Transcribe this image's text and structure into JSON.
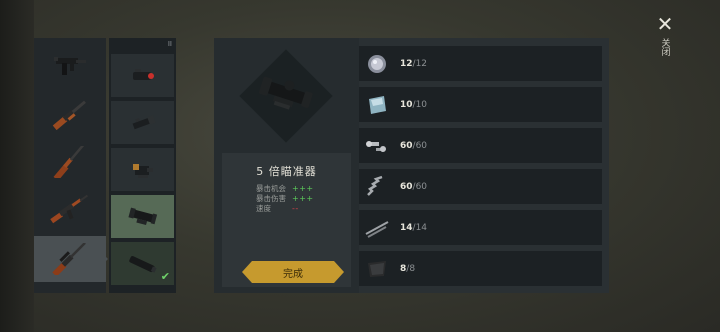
{
  "close": {
    "label": "关闭"
  },
  "item": {
    "name": "5 倍瞄准器",
    "stats": [
      {
        "label": "暴击机会",
        "value": "+++",
        "kind": "plus"
      },
      {
        "label": "暴击伤害",
        "value": "+++",
        "kind": "plus"
      },
      {
        "label": "速度",
        "value": "--",
        "kind": "minus"
      }
    ]
  },
  "done_button": {
    "label": "完成"
  },
  "attachment_badge": "II",
  "weapons": [
    {
      "icon": "smg-icon"
    },
    {
      "icon": "shotgun-icon"
    },
    {
      "icon": "hunting-rifle-icon"
    },
    {
      "icon": "assault-rifle-icon"
    },
    {
      "icon": "sniper-rifle-icon",
      "selected": true
    }
  ],
  "attachments": [
    {
      "icon": "laser-sight-icon"
    },
    {
      "icon": "flashlight-icon"
    },
    {
      "icon": "red-dot-sight-icon"
    },
    {
      "icon": "scope-icon",
      "selected": true
    },
    {
      "icon": "suppressor-icon",
      "equipped": true
    }
  ],
  "materials": [
    {
      "icon": "lens-icon",
      "have": "12",
      "need": "12"
    },
    {
      "icon": "glass-plate-icon",
      "have": "10",
      "need": "10"
    },
    {
      "icon": "screws-icon",
      "have": "60",
      "need": "60"
    },
    {
      "icon": "spring-icon",
      "have": "60",
      "need": "60"
    },
    {
      "icon": "metal-rods-icon",
      "have": "14",
      "need": "14"
    },
    {
      "icon": "leather-icon",
      "have": "8",
      "need": "8"
    }
  ],
  "colors": {
    "accent_gold": "#c69a2e",
    "plus_green": "#5cc95a",
    "minus_red": "#d8434a",
    "check_green": "#6fd26a"
  }
}
